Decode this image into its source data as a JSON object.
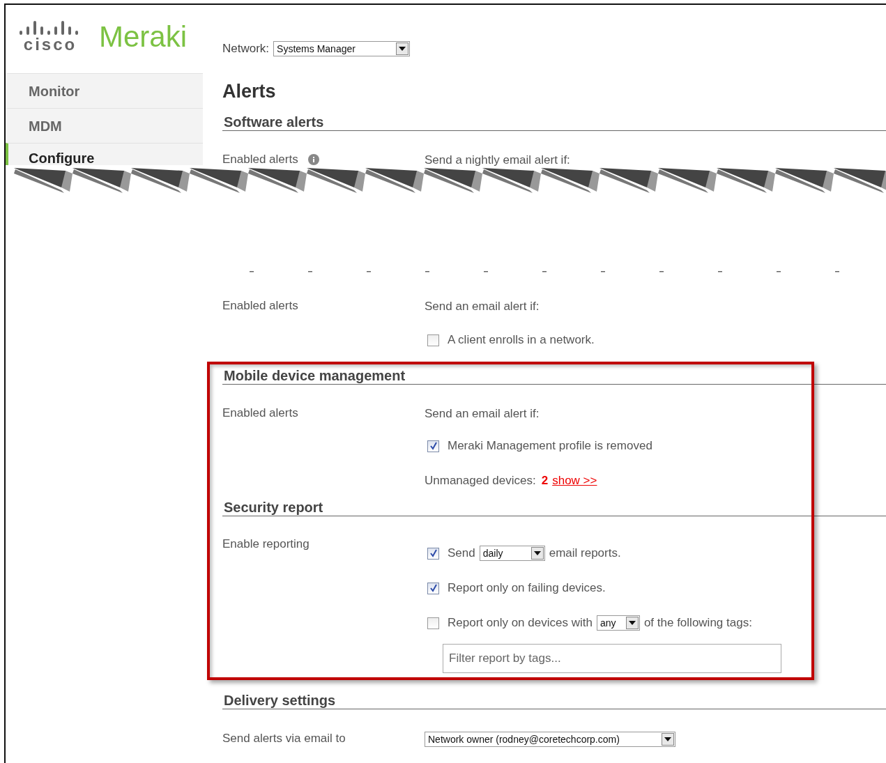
{
  "logo": {
    "brand": "cisco",
    "product": "Meraki"
  },
  "network": {
    "label": "Network:",
    "value": "Systems Manager"
  },
  "sidebar": {
    "items": [
      {
        "label": "Monitor",
        "selected": false
      },
      {
        "label": "MDM",
        "selected": false
      },
      {
        "label": "Configure",
        "selected": true
      }
    ]
  },
  "page_title": "Alerts",
  "torn_edge": true,
  "sections": [
    {
      "heading": "Software alerts",
      "highlighted": false,
      "rows": [
        {
          "label": "Enabled alerts",
          "info": true,
          "items": [
            {
              "kind": "text",
              "text": "Send a nightly email alert if:"
            }
          ]
        }
      ]
    },
    {
      "highlighted": false,
      "rows": [
        {
          "label": "Enabled alerts",
          "info": false,
          "items": [
            {
              "kind": "text",
              "text": "Send an email alert if:"
            },
            {
              "kind": "checkbox",
              "checked": false,
              "label": "A client enrolls in a network."
            }
          ]
        }
      ]
    },
    {
      "heading": "Mobile device management",
      "highlighted": true,
      "rows": [
        {
          "label": "Enabled alerts",
          "info": false,
          "items": [
            {
              "kind": "text",
              "text": "Send an email alert if:"
            },
            {
              "kind": "checkbox",
              "checked": true,
              "label": "Meraki Management profile is removed"
            },
            {
              "kind": "count",
              "label": "Unmanaged devices:",
              "count": "2",
              "link": "show >>"
            }
          ]
        }
      ]
    },
    {
      "heading": "Security report",
      "highlighted": true,
      "rows": [
        {
          "label": "Enable reporting",
          "info": false,
          "items": [
            {
              "kind": "checkbox",
              "checked": true,
              "label": "Send",
              "select": "daily",
              "after": "email reports."
            },
            {
              "kind": "checkbox",
              "checked": true,
              "label": "Report only on failing devices."
            },
            {
              "kind": "checkbox",
              "checked": false,
              "label": "Report only on devices with",
              "select": "any",
              "after": "of the following tags:"
            },
            {
              "kind": "field",
              "placeholder": "Filter report by tags..."
            }
          ]
        }
      ]
    },
    {
      "heading": "Delivery settings",
      "highlighted": false,
      "rows": [
        {
          "label": "Send alerts via email to",
          "info": false,
          "items": [
            {
              "kind": "select",
              "value": "Network owner (rodney@coretechcorp.com)"
            }
          ]
        }
      ]
    }
  ]
}
